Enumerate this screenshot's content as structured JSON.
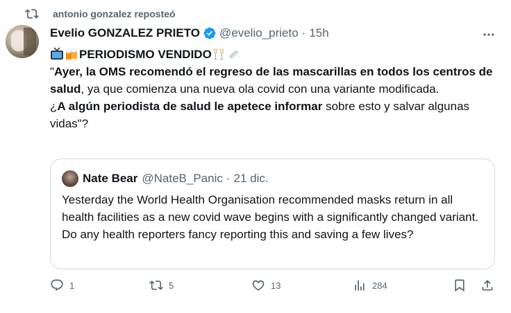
{
  "repost": {
    "text": "antonio gonzalez reposteó",
    "icon": "repost-icon"
  },
  "post": {
    "author_name": "Evelio GONZALEZ PRIETO",
    "verified_icon": "verified-badge-icon",
    "handle": "@evelio_prieto",
    "separator": "·",
    "time": "15h",
    "more_icon": "more-options-icon",
    "headline_emojis_before": [
      "tv-emoji",
      "beer-mugs-emoji"
    ],
    "headline": "PERIODISMO VENDIDO",
    "headline_emojis_after": [
      "champagne-emoji",
      "newspaper-roll-emoji"
    ],
    "p1_quote_open": "\"",
    "p1_bold": "Ayer, la OMS recomendó el regreso de las mascarillas en todos los centros de salud",
    "p1_rest": ", ya que comienza una nueva ola covid con una variante modificada.",
    "p2_start": "¿",
    "p2_bold": "A algún periodista de salud le apetece informar",
    "p2_rest": " sobre esto y salvar algunas vidas\"?"
  },
  "quoted": {
    "author_name": "Nate Bear",
    "handle": "@NateB_Panic",
    "separator": "·",
    "date": "21 dic.",
    "text": "Yesterday the World Health Organisation recommended masks return in all health facilities as a new covid wave begins with a significantly changed variant. Do any health reporters fancy reporting this and saving a few lives?"
  },
  "actions": {
    "reply": {
      "icon": "reply-icon",
      "count": "1"
    },
    "repost": {
      "icon": "repost-icon",
      "count": "5"
    },
    "like": {
      "icon": "heart-icon",
      "count": "13"
    },
    "views": {
      "icon": "views-chart-icon",
      "count": "284"
    },
    "bookmark": {
      "icon": "bookmark-icon"
    },
    "share": {
      "icon": "share-icon"
    }
  },
  "colors": {
    "text": "#0f1419",
    "muted": "#536471",
    "verified": "#1d9bf0",
    "border": "#cfd9de",
    "repost_green": "#00ba7c"
  }
}
